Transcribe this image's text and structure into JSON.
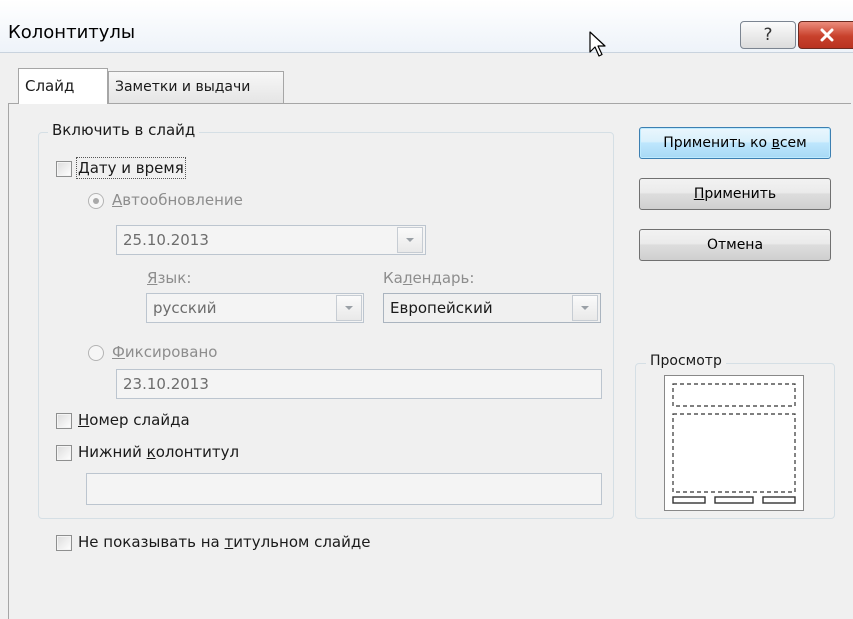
{
  "window": {
    "title": "Колонтитулы",
    "help_label": "?",
    "close_icon": "close-x-icon"
  },
  "tabs": [
    {
      "label": "Слайд",
      "active": true
    },
    {
      "label": "Заметки и выдачи",
      "active": false
    }
  ],
  "include_group": {
    "legend": "Включить в слайд",
    "date_time": {
      "label_pre": "",
      "label_ul": "Д",
      "label_post": "ату и время",
      "checked": false
    },
    "autoupdate": {
      "label_ul": "А",
      "label_post": "втообновление",
      "selected": true,
      "value": "25.10.2013"
    },
    "language": {
      "label_ul": "Я",
      "label_post": "зык:",
      "value": "русский"
    },
    "calendar": {
      "label_pre": "Ка",
      "label_ul": "л",
      "label_post": "ендарь:",
      "value": "Европейский"
    },
    "fixed": {
      "label_ul": "Ф",
      "label_post": "иксировано",
      "selected": false,
      "value": "23.10.2013"
    },
    "slide_number": {
      "label_ul": "Н",
      "label_post": "омер слайда",
      "checked": false
    },
    "footer": {
      "label_pre": "Нижний ",
      "label_ul": "к",
      "label_post": "олонтитул",
      "checked": false,
      "value": ""
    }
  },
  "dont_show_title": {
    "label_pre": "Не показывать на ",
    "label_ul": "т",
    "label_post": "итульном слайде",
    "checked": false
  },
  "buttons": {
    "apply_all_pre": "Применить ко ",
    "apply_all_ul": "в",
    "apply_all_post": "сем",
    "apply_ul": "П",
    "apply_post": "рименить",
    "cancel": "Отмена"
  },
  "preview": {
    "legend": "Просмотр"
  }
}
